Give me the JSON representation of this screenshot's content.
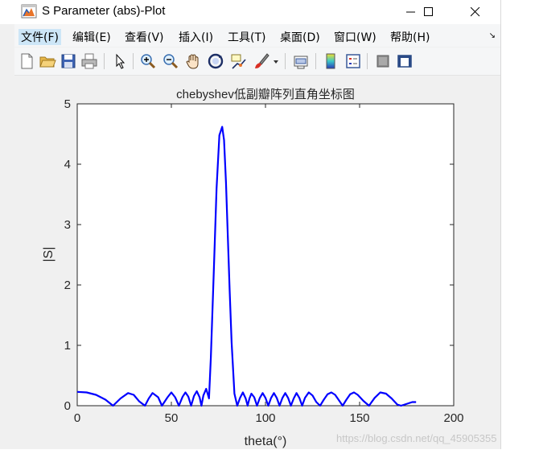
{
  "window": {
    "title": "S Parameter (abs)-Plot",
    "icon": "matlab-figure-icon",
    "controls": [
      "minimize-icon",
      "maximize-icon",
      "close-icon"
    ]
  },
  "menu": [
    {
      "label": "文件(F)"
    },
    {
      "label": "编辑(E)"
    },
    {
      "label": "查看(V)"
    },
    {
      "label": "插入(I)"
    },
    {
      "label": "工具(T)"
    },
    {
      "label": "桌面(D)"
    },
    {
      "label": "窗口(W)"
    },
    {
      "label": "帮助(H)"
    }
  ],
  "toolbar": [
    "new-figure-icon",
    "open-icon",
    "save-icon",
    "print-icon",
    "edit-plot-arrow-icon",
    "zoom-in-icon",
    "zoom-out-icon",
    "pan-hand-icon",
    "rotate-3d-icon",
    "data-cursor-icon",
    "brush-icon",
    "brush-dropdown-icon",
    "link-plot-icon",
    "insert-colorbar-icon",
    "insert-legend-icon",
    "hide-plot-tools-icon",
    "show-plot-tools-icon"
  ],
  "chart_data": {
    "type": "line",
    "title": "chebyshev低副瓣阵列直角坐标图",
    "xlabel": "theta(°)",
    "ylabel": "|S|",
    "xlim": [
      0,
      200
    ],
    "ylim": [
      0,
      5
    ],
    "xticks": [
      0,
      50,
      100,
      150,
      200
    ],
    "yticks": [
      0,
      1,
      2,
      3,
      4,
      5
    ],
    "grid": false,
    "series": [
      {
        "color": "#0000ff",
        "x": [
          0,
          5,
          10,
          15,
          19,
          23,
          27,
          30,
          33,
          36,
          38,
          40,
          43,
          45,
          48,
          50,
          52,
          54,
          56,
          57.5,
          59,
          60.5,
          62,
          63.5,
          65,
          66,
          67,
          68.5,
          70,
          71,
          72.5,
          74,
          75.5,
          77,
          78,
          79,
          80,
          81,
          82,
          83.5,
          85,
          86.5,
          88,
          89.5,
          90.5,
          91.5,
          92.5,
          94,
          95.5,
          97,
          98.5,
          100,
          101.5,
          103,
          104.5,
          106,
          107.5,
          109,
          110.5,
          112,
          113.5,
          115,
          116.5,
          118,
          119.5,
          121,
          123,
          125,
          127,
          129,
          131,
          133,
          135,
          137,
          139,
          141,
          143,
          145,
          147,
          149,
          152,
          155,
          158,
          161,
          164,
          167,
          170,
          172,
          174,
          176,
          178,
          180
        ],
        "y": [
          0.23,
          0.22,
          0.18,
          0.1,
          0.0,
          0.12,
          0.21,
          0.18,
          0.07,
          0.0,
          0.12,
          0.21,
          0.14,
          0.0,
          0.14,
          0.22,
          0.14,
          0.0,
          0.15,
          0.22,
          0.15,
          0.0,
          0.16,
          0.24,
          0.14,
          0.0,
          0.17,
          0.28,
          0.12,
          0.8,
          2.2,
          3.6,
          4.48,
          4.62,
          4.4,
          3.7,
          2.8,
          1.9,
          1.05,
          0.2,
          0.0,
          0.13,
          0.22,
          0.12,
          0.0,
          0.12,
          0.2,
          0.14,
          0.0,
          0.13,
          0.21,
          0.13,
          0.0,
          0.13,
          0.21,
          0.13,
          0.0,
          0.13,
          0.21,
          0.13,
          0.0,
          0.12,
          0.21,
          0.13,
          0.0,
          0.13,
          0.22,
          0.17,
          0.06,
          0.0,
          0.1,
          0.19,
          0.22,
          0.18,
          0.09,
          0.0,
          0.1,
          0.19,
          0.22,
          0.18,
          0.08,
          0.0,
          0.13,
          0.22,
          0.2,
          0.12,
          0.02,
          0.0,
          0.02,
          0.04,
          0.06,
          0.06
        ]
      }
    ]
  },
  "watermark": "https://blog.csdn.net/qq_45905355"
}
